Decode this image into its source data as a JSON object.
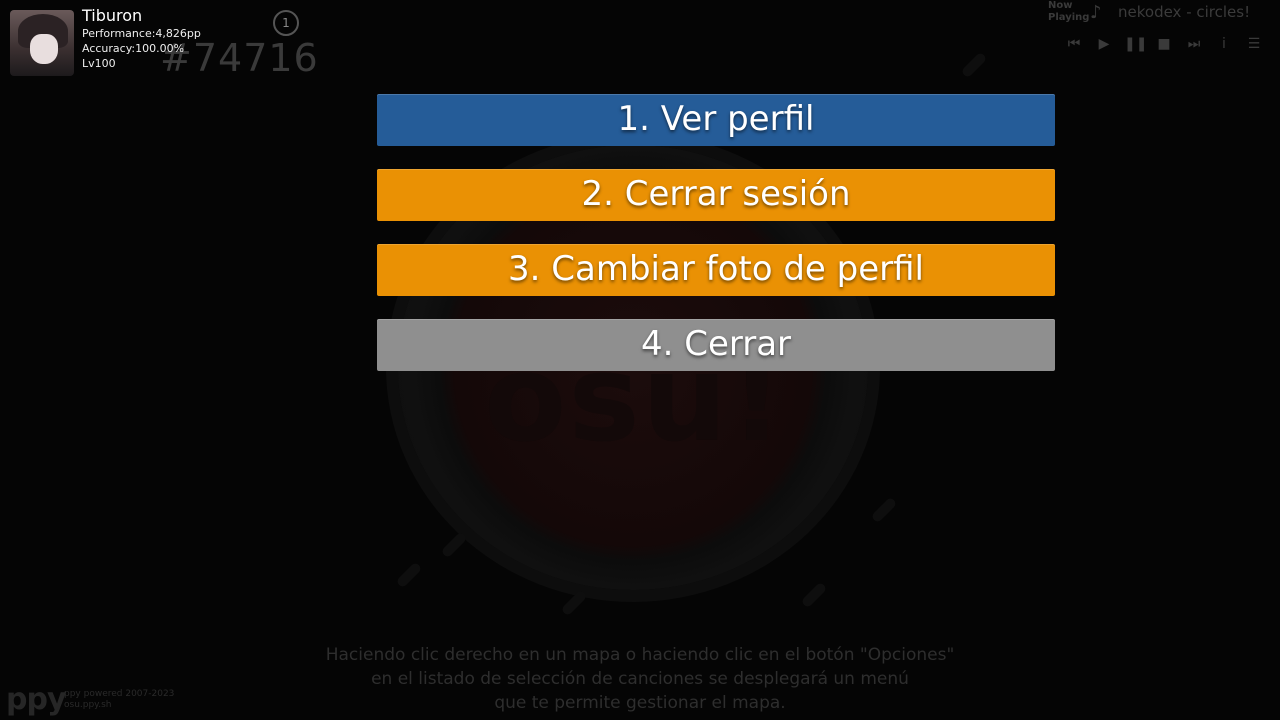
{
  "user": {
    "name": "Tiburon",
    "performance": "Performance:4,826pp",
    "accuracy": "Accuracy:100.00%",
    "level": "Lv100",
    "rank": "#74716",
    "badge": "1"
  },
  "now_playing": {
    "label_line1": "Now",
    "label_line2": "Playing",
    "track": "nekodex - circles!",
    "controls": [
      "previous-icon",
      "play-icon",
      "pause-icon",
      "stop-icon",
      "next-icon",
      "info-icon",
      "menu-icon"
    ]
  },
  "menu": {
    "items": [
      {
        "label": "1. Ver perfil",
        "color": "#255c98"
      },
      {
        "label": "2. Cerrar sesión",
        "color": "#ea9104"
      },
      {
        "label": "3. Cambiar foto de perfil",
        "color": "#ea9104"
      },
      {
        "label": "4. Cerrar",
        "color": "#8f8f8f"
      }
    ]
  },
  "tip": {
    "line1": "Haciendo clic derecho en un mapa o haciendo clic en el botón \"Opciones\"",
    "line2": "en el listado de selección de canciones se desplegará un menú",
    "line3": "que te permite gestionar el mapa."
  },
  "footer": {
    "logo": "ppy",
    "credit_line1": "ppy powered 2007-2023",
    "credit_line2": "osu.ppy.sh"
  },
  "background": {
    "logo_text": "osu!"
  }
}
